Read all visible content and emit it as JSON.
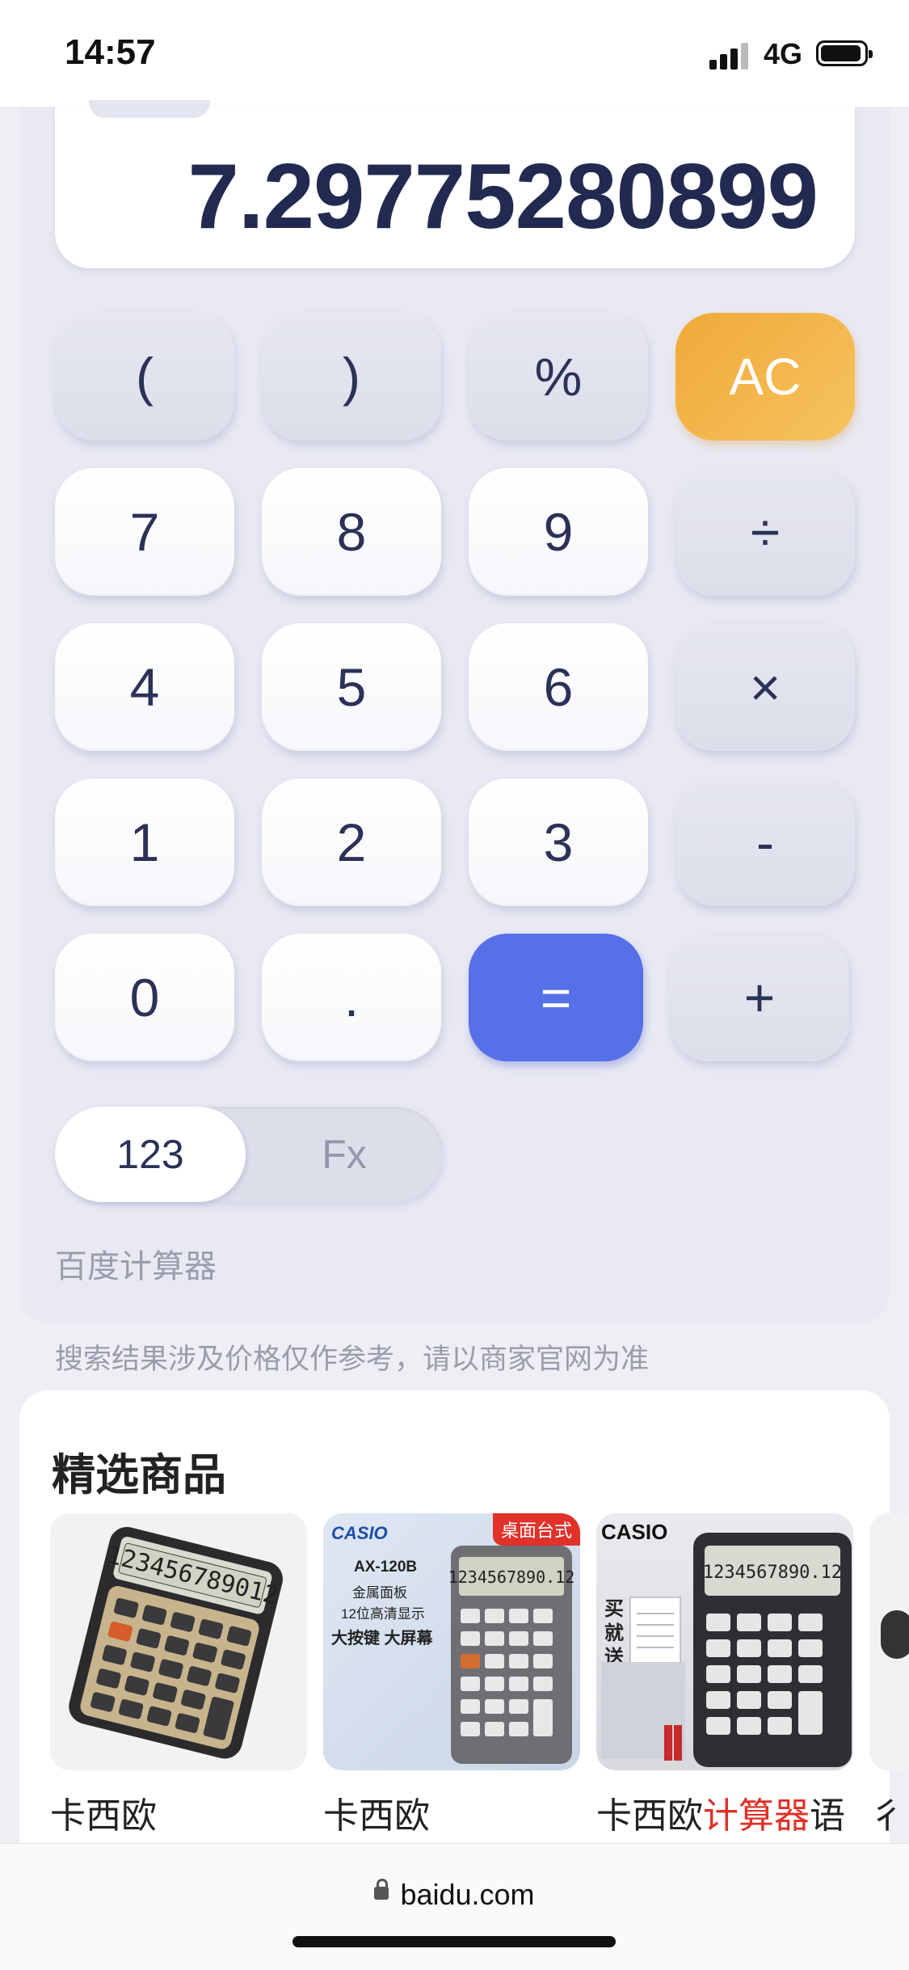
{
  "status_bar": {
    "time": "14:57",
    "network": "4G"
  },
  "calculator": {
    "display_value": "7.29775280899",
    "keys": {
      "open_paren": "(",
      "close_paren": ")",
      "percent": "%",
      "clear": "AC",
      "seven": "7",
      "eight": "8",
      "nine": "9",
      "divide": "÷",
      "four": "4",
      "five": "5",
      "six": "6",
      "multiply": "×",
      "one": "1",
      "two": "2",
      "three": "3",
      "minus": "-",
      "zero": "0",
      "decimal": ".",
      "equals": "=",
      "plus": "+"
    },
    "modes": {
      "basic": "123",
      "function": "Fx",
      "selected": "123"
    },
    "brand": "百度计算器",
    "colors": {
      "accent_orange": "#f0a93a",
      "accent_blue": "#5670e8"
    }
  },
  "disclaimer": "搜索结果涉及价格仅作参考，请以商家官网为准",
  "products": {
    "title": "精选商品",
    "items": [
      {
        "name": "卡西欧"
      },
      {
        "name": "卡西欧",
        "tag": "桌面台式",
        "logo": "CASIO",
        "model": "AX-120B",
        "line1": "金属面板",
        "line2": "12位高清显示",
        "line3": "大按键 大屏幕"
      },
      {
        "name_prefix": "卡西欧",
        "name_highlight": "计算器",
        "name_suffix": "语",
        "logo": "CASIO",
        "side_text": "买就送"
      },
      {
        "name": "彳"
      }
    ]
  },
  "browser": {
    "url": "baidu.com"
  }
}
